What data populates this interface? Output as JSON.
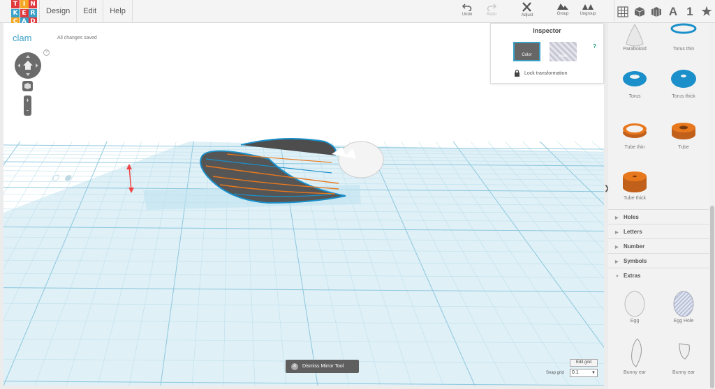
{
  "logo": {
    "letters": [
      "T",
      "I",
      "N",
      "K",
      "E",
      "R",
      "C",
      "A",
      "D"
    ],
    "colors": [
      "#e03a3e",
      "#f5a623",
      "#e03a3e",
      "#3aa1c8",
      "#e03a3e",
      "#3aa1c8",
      "#f5a623",
      "#3aa1c8",
      "#e03a3e"
    ]
  },
  "menu": [
    "Design",
    "Edit",
    "Help"
  ],
  "toolbar": {
    "undo": "Undo",
    "redo": "Redo",
    "adjust": "Adjust",
    "group": "Group",
    "ungroup": "Ungroup"
  },
  "views": {
    "letter": "A",
    "number": "1"
  },
  "design": {
    "title": "clam",
    "status": "All changes saved"
  },
  "nav": {
    "help": "?",
    "zoom_in": "+",
    "zoom_out": "-"
  },
  "inspector": {
    "title": "Inspector",
    "color_label": "Color",
    "hole_label": "Hole",
    "lock_label": "Lock transformation",
    "help": "?"
  },
  "bottom": {
    "dismiss": "Dismiss Mirror Tool",
    "edit_grid": "Edit grid",
    "snap_label": "Snap grid",
    "snap_value": "0.1"
  },
  "shapes": [
    {
      "label": "Paraboloid",
      "icon": "paraboloid-icon"
    },
    {
      "label": "Torus thin",
      "icon": "torus-thin-icon"
    },
    {
      "label": "Torus",
      "icon": "torus-icon"
    },
    {
      "label": "Torus thick",
      "icon": "torus-thick-icon"
    },
    {
      "label": "Tube thin",
      "icon": "tube-thin-icon"
    },
    {
      "label": "Tube",
      "icon": "tube-icon"
    },
    {
      "label": "Tube thick",
      "icon": "tube-thick-icon"
    }
  ],
  "categories": [
    "Holes",
    "Letters",
    "Number",
    "Symbols",
    "Extras"
  ],
  "extras": [
    {
      "label": "Egg",
      "icon": "egg-icon"
    },
    {
      "label": "Egg Hole",
      "icon": "egg-hole-icon"
    },
    {
      "label": "Bunny ear",
      "icon": "bunny-ear-icon"
    },
    {
      "label": "Bunny ear",
      "icon": "bunny-ear-2-icon"
    }
  ],
  "colors": {
    "accent": "#3aa1c8",
    "orange": "#e8781e",
    "blue_shape": "#1a8fc9",
    "dark": "#5f5f5f"
  }
}
